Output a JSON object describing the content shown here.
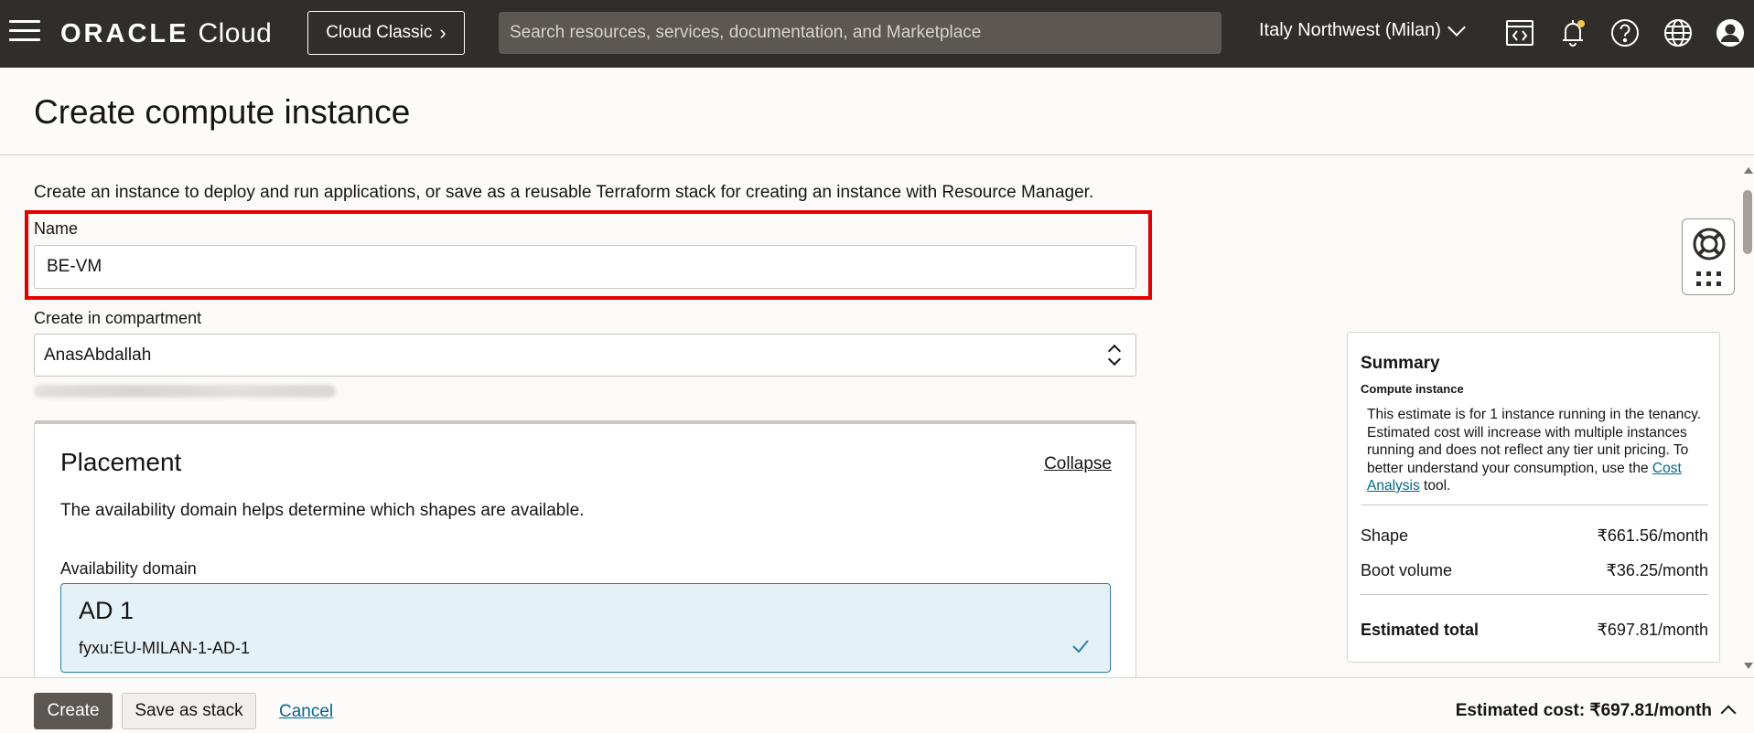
{
  "topbar": {
    "logo_brand": "ORACLE",
    "logo_product": "Cloud",
    "classic_button": "Cloud Classic",
    "search_placeholder": "Search resources, services, documentation, and Marketplace",
    "region": "Italy Northwest (Milan)",
    "icons": [
      "hamburger-menu-icon",
      "code-editor-icon",
      "bell-icon",
      "help-icon",
      "globe-icon",
      "user-profile-icon"
    ]
  },
  "header": {
    "title": "Create compute instance"
  },
  "form": {
    "intro": "Create an instance to deploy and run applications, or save as a reusable Terraform stack for creating an instance with Resource Manager.",
    "name_label": "Name",
    "name_value": "BE-VM",
    "compartment_label": "Create in compartment",
    "compartment_value": "AnasAbdallah"
  },
  "placement": {
    "title": "Placement",
    "collapse": "Collapse",
    "description": "The availability domain helps determine which shapes are available.",
    "ad_label": "Availability domain",
    "ad_name": "AD 1",
    "ad_id": "fyxu:EU-MILAN-1-AD-1"
  },
  "summary": {
    "title": "Summary",
    "subtitle": "Compute instance",
    "text_before_link": "This estimate is for 1 instance running in the tenancy. Estimated cost will increase with multiple instances running and does not reflect any tier unit pricing. To better understand your consumption, use the ",
    "link": "Cost Analysis",
    "text_after_link": " tool.",
    "rows": [
      {
        "label": "Shape",
        "value": "₹661.56/month"
      },
      {
        "label": "Boot volume",
        "value": "₹36.25/month"
      }
    ],
    "total_label": "Estimated total",
    "total_value": "₹697.81/month"
  },
  "footer": {
    "create": "Create",
    "save_stack": "Save as stack",
    "cancel": "Cancel",
    "estimated_cost": "Estimated cost: ₹697.81/month"
  },
  "colors": {
    "topbar_bg": "#312d2a",
    "highlight_border": "#e50000",
    "selected_card_bg": "#e4f1f6",
    "selected_card_border": "#2b7ca8",
    "link": "#00688c"
  }
}
